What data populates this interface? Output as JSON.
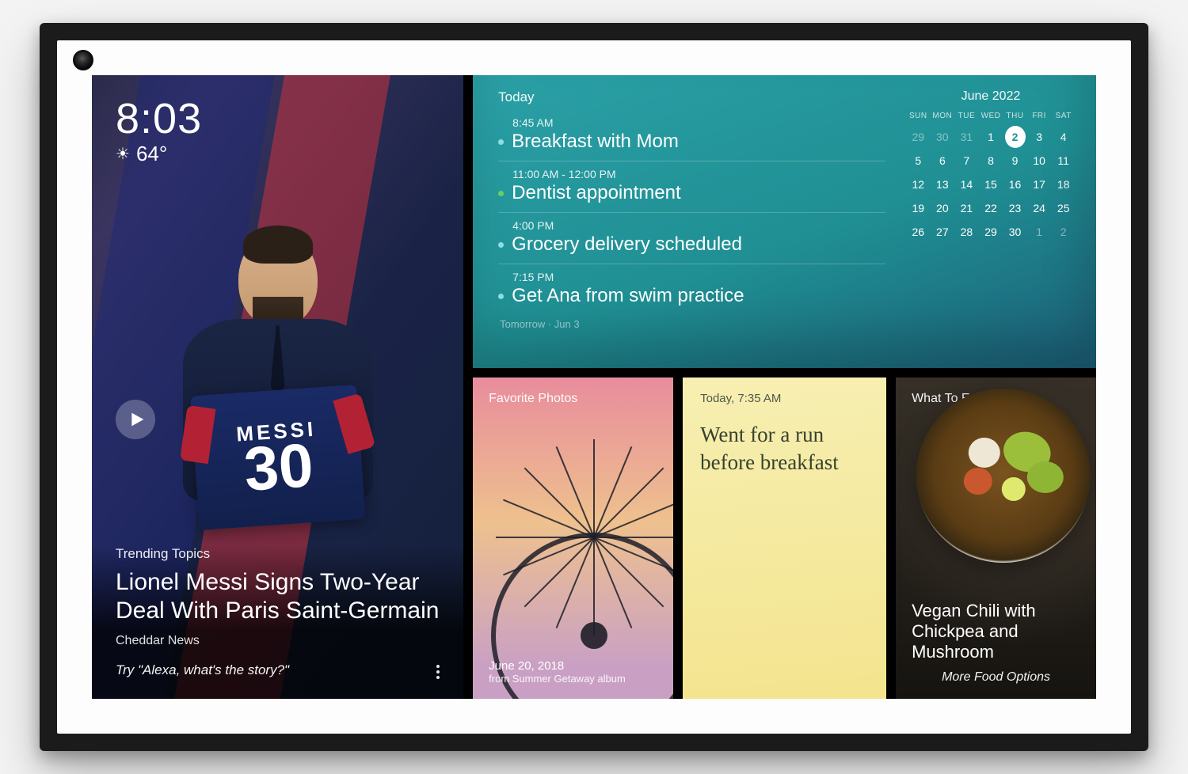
{
  "clock": {
    "time": "8:03",
    "temp": "64°",
    "weather_icon": "☀"
  },
  "news": {
    "label": "Trending Topics",
    "headline": "Lionel Messi Signs Two-Year Deal With Paris Saint-Germain",
    "source": "Cheddar News",
    "hint": "Try \"Alexa, what's the story?\"",
    "jersey_name": "MESSI",
    "jersey_number": "30"
  },
  "agenda": {
    "header": "Today",
    "footer": "Tomorrow · Jun 3",
    "events": [
      {
        "time": "8:45 AM",
        "title": "Breakfast with Mom",
        "color": "#8fe0e4"
      },
      {
        "time": "11:00 AM - 12:00 PM",
        "title": "Dentist appointment",
        "color": "#6fcf63"
      },
      {
        "time": "4:00 PM",
        "title": "Grocery delivery scheduled",
        "color": "#8fe0e4"
      },
      {
        "time": "7:15 PM",
        "title": "Get Ana from swim practice",
        "color": "#8fe0e4"
      }
    ]
  },
  "calendar": {
    "title": "June 2022",
    "dow": [
      "SUN",
      "MON",
      "TUE",
      "WED",
      "THU",
      "FRI",
      "SAT"
    ],
    "today": 2,
    "weeks": [
      [
        {
          "n": 29,
          "dim": true
        },
        {
          "n": 30,
          "dim": true
        },
        {
          "n": 31,
          "dim": true
        },
        {
          "n": 1
        },
        {
          "n": 2,
          "today": true
        },
        {
          "n": 3
        },
        {
          "n": 4
        }
      ],
      [
        {
          "n": 5
        },
        {
          "n": 6
        },
        {
          "n": 7
        },
        {
          "n": 8
        },
        {
          "n": 9
        },
        {
          "n": 10
        },
        {
          "n": 11
        }
      ],
      [
        {
          "n": 12
        },
        {
          "n": 13
        },
        {
          "n": 14
        },
        {
          "n": 15
        },
        {
          "n": 16
        },
        {
          "n": 17
        },
        {
          "n": 18
        }
      ],
      [
        {
          "n": 19
        },
        {
          "n": 20
        },
        {
          "n": 21
        },
        {
          "n": 22
        },
        {
          "n": 23
        },
        {
          "n": 24
        },
        {
          "n": 25
        }
      ],
      [
        {
          "n": 26
        },
        {
          "n": 27
        },
        {
          "n": 28
        },
        {
          "n": 29
        },
        {
          "n": 30
        },
        {
          "n": 1,
          "dim": true
        },
        {
          "n": 2,
          "dim": true
        }
      ]
    ]
  },
  "photos": {
    "title": "Favorite Photos",
    "date": "June 20, 2018",
    "album": "from Summer Getaway album"
  },
  "note": {
    "title": "Today, 7:35 AM",
    "body": "Went for a run before breakfast"
  },
  "food": {
    "title": "What To Eat",
    "name": "Vegan Chili with Chickpea and Mushroom",
    "more": "More Food Options"
  }
}
